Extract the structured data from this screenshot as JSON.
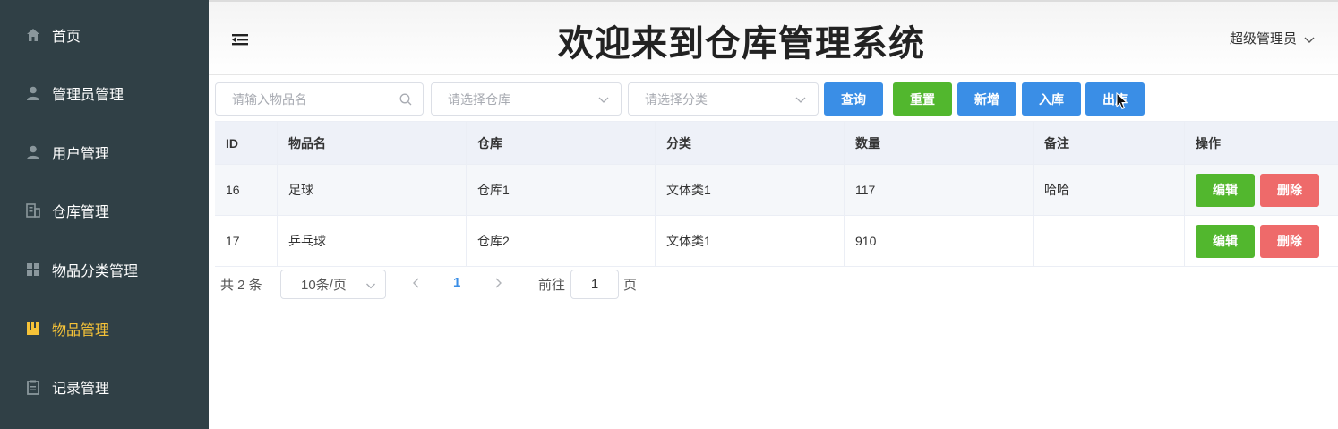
{
  "sidebar": {
    "items": [
      {
        "label": "首页",
        "icon": "home-icon"
      },
      {
        "label": "管理员管理",
        "icon": "user-icon"
      },
      {
        "label": "用户管理",
        "icon": "user-icon"
      },
      {
        "label": "仓库管理",
        "icon": "building-icon"
      },
      {
        "label": "物品分类管理",
        "icon": "grid-icon"
      },
      {
        "label": "物品管理",
        "icon": "box-icon",
        "active": true
      },
      {
        "label": "记录管理",
        "icon": "clipboard-icon"
      }
    ],
    "active_color": "#f6c338"
  },
  "header": {
    "title": "欢迎来到仓库管理系统",
    "user": "超级管理员"
  },
  "filters": {
    "name_placeholder": "请输入物品名",
    "warehouse_placeholder": "请选择仓库",
    "category_placeholder": "请选择分类"
  },
  "toolbar": {
    "query": "查询",
    "reset": "重置",
    "add": "新增",
    "stock_in": "入库",
    "stock_out": "出库"
  },
  "table": {
    "columns": [
      "ID",
      "物品名",
      "仓库",
      "分类",
      "数量",
      "备注",
      "操作"
    ],
    "rows": [
      {
        "id": "16",
        "name": "足球",
        "warehouse": "仓库1",
        "category": "文体类1",
        "quantity": "117",
        "remark": "哈哈"
      },
      {
        "id": "17",
        "name": "乒乓球",
        "warehouse": "仓库2",
        "category": "文体类1",
        "quantity": "910",
        "remark": ""
      }
    ],
    "edit_label": "编辑",
    "delete_label": "删除"
  },
  "pagination": {
    "total": "共 2 条",
    "page_size": "10条/页",
    "current_page": "1",
    "goto_label": "前往",
    "goto_value": "1",
    "page_unit": "页"
  },
  "colors": {
    "sidebar_bg": "#304046",
    "primary": "#3a8ee6",
    "success": "#52b72e",
    "danger": "#ee6a6a"
  }
}
